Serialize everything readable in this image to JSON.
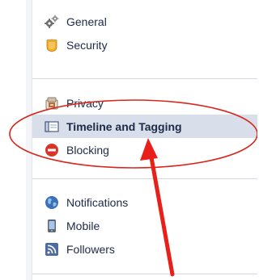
{
  "sidebar": {
    "group_one": [
      {
        "label": "General",
        "icon": "gears-icon"
      },
      {
        "label": "Security",
        "icon": "security-badge-icon"
      }
    ],
    "group_two": [
      {
        "label": "Privacy",
        "icon": "privacy-lock-icon"
      },
      {
        "label": "Timeline and Tagging",
        "icon": "timeline-icon",
        "selected": true
      },
      {
        "label": "Blocking",
        "icon": "blocking-icon"
      }
    ],
    "group_three": [
      {
        "label": "Notifications",
        "icon": "globe-icon"
      },
      {
        "label": "Mobile",
        "icon": "mobile-phone-icon"
      },
      {
        "label": "Followers",
        "icon": "rss-feed-icon"
      }
    ]
  },
  "annotation": {
    "ellipse_color": "#d9261c",
    "arrow_color": "#e8201a"
  },
  "colors": {
    "selected_background": "#d8dfea",
    "text": "#1c2a47",
    "divider": "#d4d8e2"
  }
}
